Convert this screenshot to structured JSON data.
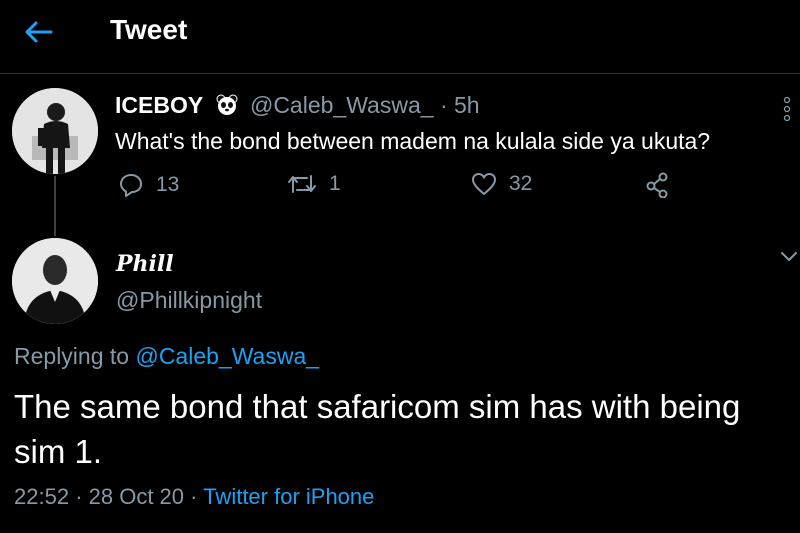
{
  "header": {
    "title": "Tweet"
  },
  "quoted_tweet": {
    "name": "ICEBOY",
    "handle": "@Caleb_Waswa_",
    "separator": "·",
    "time": "5h",
    "text": "What's the bond between madem na kulala side ya ukuta?",
    "replies": "13",
    "retweets": "1",
    "likes": "32"
  },
  "reply_tweet": {
    "name": "Phill",
    "handle": "@Phillkipnight",
    "replying_prefix": "Replying to",
    "replying_to": "@Caleb_Waswa_",
    "text": "The same bond that safaricom sim has with being sim 1.",
    "time": "22:52",
    "separator": "·",
    "date": "28 Oct 20",
    "client": "Twitter for iPhone"
  },
  "colors": {
    "accent": "#1da1f2",
    "muted": "#8899a6",
    "background": "#000000"
  }
}
